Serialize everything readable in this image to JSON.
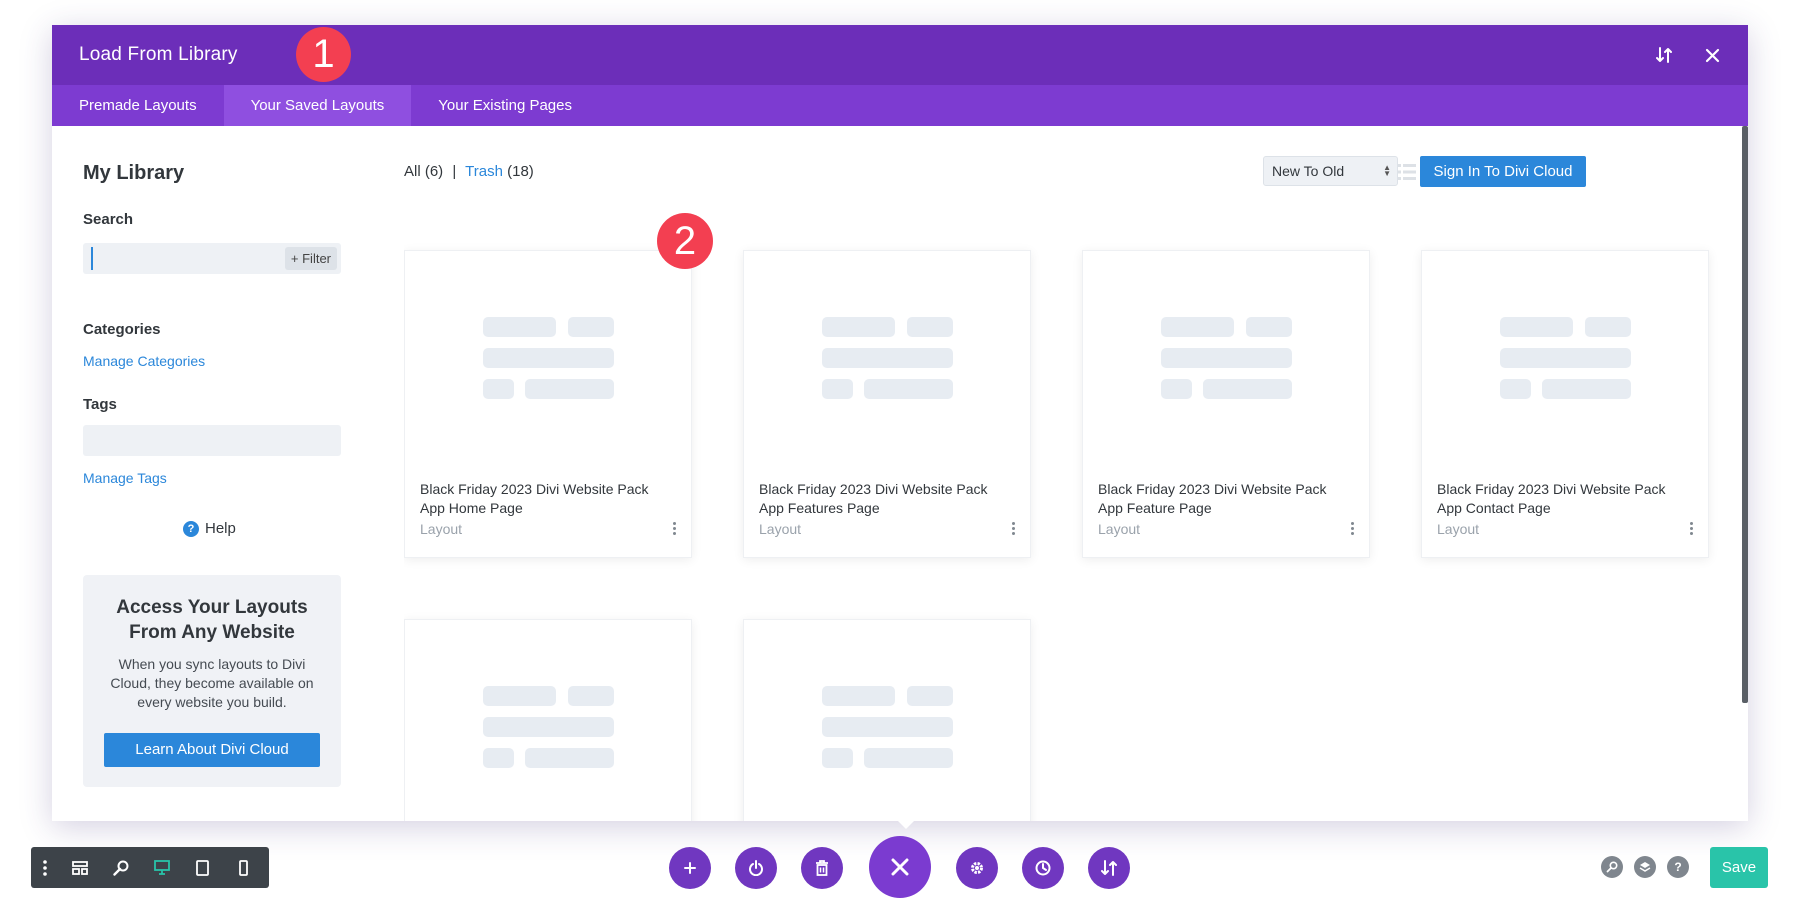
{
  "modal": {
    "title": "Load From Library",
    "tabs": [
      {
        "label": "Premade Layouts"
      },
      {
        "label": "Your Saved Layouts"
      },
      {
        "label": "Your Existing Pages"
      }
    ]
  },
  "badges": {
    "one": "1",
    "two": "2"
  },
  "sidebar": {
    "title": "My Library",
    "search_label": "Search",
    "search_value": "",
    "filter_label": "+ Filter",
    "categories_label": "Categories",
    "manage_categories": "Manage Categories",
    "tags_label": "Tags",
    "manage_tags": "Manage Tags",
    "help_label": "Help",
    "promo": {
      "title": "Access Your Layouts From Any Website",
      "text": "When you sync layouts to Divi Cloud, they become available on every website you build.",
      "button": "Learn About Divi Cloud"
    }
  },
  "main": {
    "all_label": "All (6)",
    "separator": "|",
    "trash_label": "Trash",
    "trash_count": "(18)",
    "sort_value": "New To Old",
    "signin_label": "Sign In To Divi Cloud",
    "cards": [
      {
        "title": "Black Friday 2023 Divi Website Pack App Home Page",
        "type": "Layout"
      },
      {
        "title": "Black Friday 2023 Divi Website Pack App Features Page",
        "type": "Layout"
      },
      {
        "title": "Black Friday 2023 Divi Website Pack App Feature Page",
        "type": "Layout"
      },
      {
        "title": "Black Friday 2023 Divi Website Pack App Contact Page",
        "type": "Layout"
      },
      {
        "title": "",
        "type": ""
      },
      {
        "title": "",
        "type": ""
      }
    ]
  },
  "bottom": {
    "save_label": "Save"
  },
  "colors": {
    "header": "#6c2eb9",
    "tabs": "#7d3bd1",
    "accent_blue": "#2b87da",
    "badge": "#f33f51",
    "save": "#29c4a9"
  }
}
